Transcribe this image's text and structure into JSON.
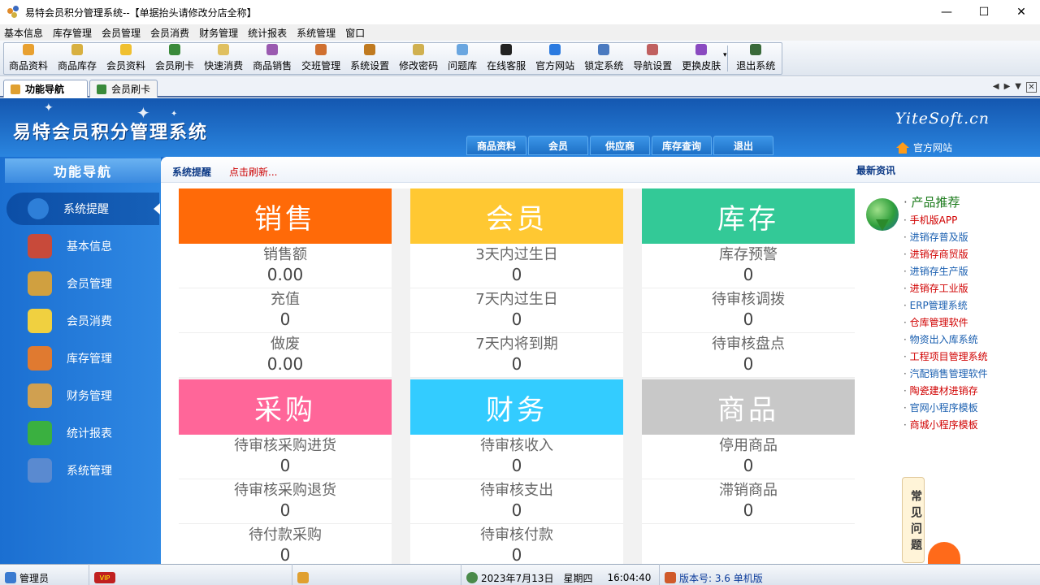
{
  "window": {
    "title": "易特会员积分管理系统--【单据抬头请修改分店全称】"
  },
  "menu": [
    "基本信息",
    "库存管理",
    "会员管理",
    "会员消费",
    "财务管理",
    "统计报表",
    "系统管理",
    "窗口"
  ],
  "toolbar": [
    {
      "label": "商品资料",
      "icon": "goods-icon",
      "color": "#e8a030"
    },
    {
      "label": "商品库存",
      "icon": "stock-icon",
      "color": "#d8b040"
    },
    {
      "label": "会员资料",
      "icon": "member-icon",
      "color": "#f0c030"
    },
    {
      "label": "会员刷卡",
      "icon": "card-icon",
      "color": "#3a8a3a"
    },
    {
      "label": "快速消费",
      "icon": "consume-icon",
      "color": "#e0c060"
    },
    {
      "label": "商品销售",
      "icon": "sale-icon",
      "color": "#9a5ab0"
    },
    {
      "label": "交班管理",
      "icon": "shift-icon",
      "color": "#d07030"
    },
    {
      "label": "系统设置",
      "icon": "settings-icon",
      "color": "#c07a20"
    },
    {
      "label": "修改密码",
      "icon": "password-icon",
      "color": "#d0b050"
    },
    {
      "label": "问题库",
      "icon": "question-icon",
      "color": "#6aa6e0"
    },
    {
      "label": "在线客服",
      "icon": "qq-icon",
      "color": "#222222"
    },
    {
      "label": "官方网站",
      "icon": "ie-icon",
      "color": "#2a7ae0"
    },
    {
      "label": "锁定系统",
      "icon": "lock-icon",
      "color": "#4a7ac0"
    },
    {
      "label": "导航设置",
      "icon": "nav-icon",
      "color": "#c06060"
    },
    {
      "label": "更换皮肤",
      "icon": "skin-icon",
      "color": "#8a4ac0"
    },
    {
      "label": "退出系统",
      "icon": "exit-icon",
      "color": "#3a6a3a"
    }
  ],
  "tabs": [
    {
      "label": "功能导航"
    },
    {
      "label": "会员刷卡"
    }
  ],
  "header": {
    "logo": "易特会员积分管理系统",
    "brand": "YiteSoft.cn",
    "site": "官方网站",
    "nav": [
      "商品资料",
      "会员",
      "供应商",
      "库存查询",
      "退出"
    ]
  },
  "sidebar": {
    "title": "功能导航",
    "items": [
      {
        "label": "系统提醒",
        "color": "#2e7fd8"
      },
      {
        "label": "基本信息",
        "color": "#c84a3a"
      },
      {
        "label": "会员管理",
        "color": "#d0a040"
      },
      {
        "label": "会员消费",
        "color": "#f0d040"
      },
      {
        "label": "库存管理",
        "color": "#e07a30"
      },
      {
        "label": "财务管理",
        "color": "#d0a050"
      },
      {
        "label": "统计报表",
        "color": "#3ab040"
      },
      {
        "label": "系统管理",
        "color": "#5a8ad0"
      }
    ]
  },
  "content": {
    "crumb": "系统提醒",
    "refresh": "点击刷新...",
    "news_title": "最新资讯"
  },
  "cards": [
    {
      "title": "销售",
      "color": "#ff6a08",
      "rows": [
        {
          "label": "销售额",
          "value": "0.00"
        },
        {
          "label": "充值",
          "value": "0"
        },
        {
          "label": "做废",
          "value": "0.00"
        }
      ]
    },
    {
      "title": "会员",
      "color": "#ffc832",
      "rows": [
        {
          "label": "3天内过生日",
          "value": "0"
        },
        {
          "label": "7天内过生日",
          "value": "0"
        },
        {
          "label": "7天内将到期",
          "value": "0"
        }
      ]
    },
    {
      "title": "库存",
      "color": "#33c997",
      "rows": [
        {
          "label": "库存预警",
          "value": "0"
        },
        {
          "label": "待审核调拨",
          "value": "0"
        },
        {
          "label": "待审核盘点",
          "value": "0"
        }
      ]
    },
    {
      "title": "采购",
      "color": "#ff6699",
      "rows": [
        {
          "label": "待审核采购进货",
          "value": "0"
        },
        {
          "label": "待审核采购退货",
          "value": "0"
        },
        {
          "label": "待付款采购",
          "value": "0"
        }
      ]
    },
    {
      "title": "财务",
      "color": "#33ccff",
      "rows": [
        {
          "label": "待审核收入",
          "value": "0"
        },
        {
          "label": "待审核支出",
          "value": "0"
        },
        {
          "label": "待审核付款",
          "value": "0"
        }
      ]
    },
    {
      "title": "商品",
      "color": "#c8c8c8",
      "rows": [
        {
          "label": "停用商品",
          "value": "0"
        },
        {
          "label": "滞销商品",
          "value": "0"
        }
      ]
    }
  ],
  "news": {
    "heading": "产品推荐",
    "items": [
      {
        "label": "手机版APP",
        "color": "#d00000"
      },
      {
        "label": "进销存普及版",
        "color": "#1a5fb0"
      },
      {
        "label": "进销存商贸版",
        "color": "#d00000"
      },
      {
        "label": "进销存生产版",
        "color": "#1a5fb0"
      },
      {
        "label": "进销存工业版",
        "color": "#d00000"
      },
      {
        "label": "ERP管理系统",
        "color": "#1a5fb0"
      },
      {
        "label": "仓库管理软件",
        "color": "#d00000"
      },
      {
        "label": "物资出入库系统",
        "color": "#1a5fb0"
      },
      {
        "label": "工程项目管理系统",
        "color": "#d00000"
      },
      {
        "label": "汽配销售管理软件",
        "color": "#1a5fb0"
      },
      {
        "label": "陶瓷建材进销存",
        "color": "#d00000"
      },
      {
        "label": "官网小程序模板",
        "color": "#1a5fb0"
      },
      {
        "label": "商城小程序模板",
        "color": "#d00000"
      }
    ],
    "faq": "常见问题"
  },
  "status": {
    "user": "管理员",
    "vip": "VIP",
    "date": "2023年7月13日",
    "weekday": "星期四",
    "time": "16:04:40",
    "version": "版本号: 3.6 单机版"
  }
}
